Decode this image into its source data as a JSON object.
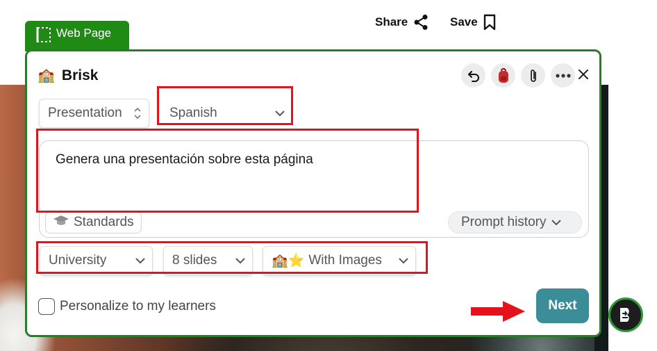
{
  "page": {
    "share_label": "Share",
    "save_label": "Save"
  },
  "tab": {
    "label": "Web Page",
    "icon": "selection-frame-icon"
  },
  "panel": {
    "brand_emoji": "🏫",
    "brand_name": "Brisk",
    "toolbar_icons": [
      "undo-icon",
      "backpack-icon",
      "paperclip-icon",
      "more-icon"
    ],
    "close_icon": "close-icon"
  },
  "form": {
    "output_type": "Presentation",
    "language": "Spanish",
    "prompt": "Genera una presentación sobre esta página",
    "standards_label": "Standards",
    "prompt_history_label": "Prompt history",
    "level": "University",
    "slides": "8 slides",
    "images_emoji": "🏫⭐",
    "images_option": "With Images",
    "personalize_label": "Personalize to my learners",
    "personalize_checked": false,
    "next_label": "Next"
  },
  "colors": {
    "tab_green": "#1f8a14",
    "panel_border": "#2d7a2d",
    "next_button": "#3b8e97",
    "annotation_red": "#e3121b"
  }
}
